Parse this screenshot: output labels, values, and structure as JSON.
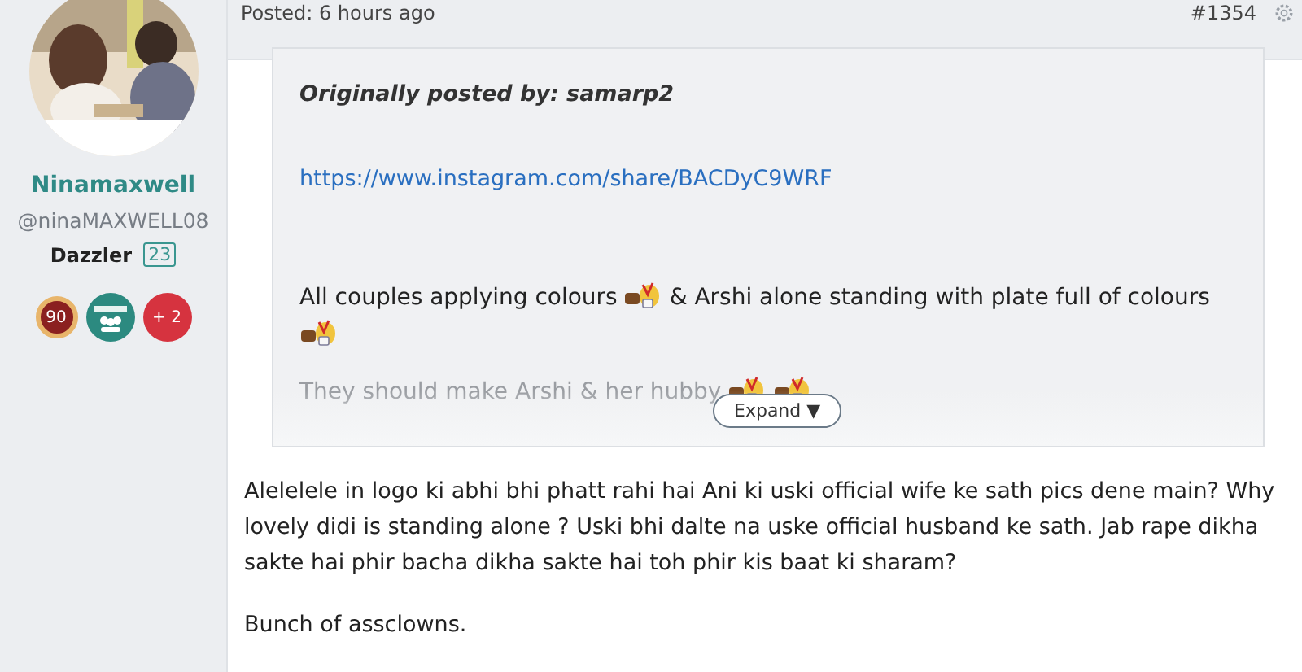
{
  "author": {
    "name": "Ninamaxwell",
    "handle": "@ninaMAXWELL08",
    "rank": "Dazzler",
    "rank_level": "23",
    "badges": [
      {
        "kind": "medal",
        "label": "90"
      },
      {
        "kind": "group"
      },
      {
        "kind": "more",
        "label": "+ 2"
      }
    ]
  },
  "post": {
    "posted": "Posted: 6 hours ago",
    "number": "#1354",
    "quote": {
      "by": "Originally posted by: samarp2",
      "link": "https://www.instagram.com/share/BACDyC9WRF",
      "paragraphs": [
        [
          {
            "kind": "text",
            "text": "All couples applying colours"
          },
          {
            "kind": "emoji"
          },
          {
            "kind": "text",
            "text": "& Arshi alone standing with plate full of colours"
          },
          {
            "kind": "emoji"
          }
        ],
        [
          {
            "kind": "text",
            "text": "They should make Arshi & her hubby"
          },
          {
            "kind": "emoji"
          },
          {
            "kind": "emoji"
          }
        ]
      ],
      "expand": "Expand ▼"
    },
    "body": [
      "Alelelele in logo ki abhi bhi phatt rahi hai Ani ki uski official wife ke sath pics dene main? Why lovely didi is standing alone ? Uski bhi dalte na uske official husband ke sath. Jab rape dikha sakte hai phir bacha dikha sakte hai toh phir kis baat ki sharam?",
      "Bunch of assclowns."
    ]
  }
}
